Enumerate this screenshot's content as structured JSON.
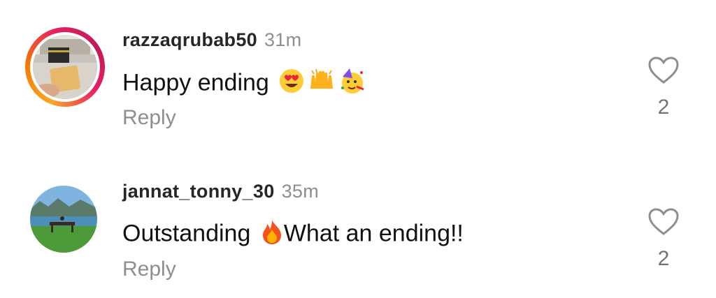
{
  "comments": [
    {
      "username": "razzaqrubab50",
      "time": "31m",
      "text": "Happy ending",
      "emojis": [
        "heart-eyes-emoji",
        "raising-hands-emoji",
        "partying-face-emoji"
      ],
      "reply_label": "Reply",
      "likes": "2",
      "avatar_ring": true
    },
    {
      "username": "jannat_tonny_30",
      "time": "35m",
      "text_before": "Outstanding",
      "emoji": "fire-emoji",
      "text_after": "What an ending!!",
      "reply_label": "Reply",
      "likes": "2",
      "avatar_ring": false
    }
  ],
  "colors": {
    "username": "#262626",
    "meta": "#8e8e8e",
    "text": "#111111",
    "ring_start": "#f9a825",
    "ring_end": "#e91e63"
  }
}
